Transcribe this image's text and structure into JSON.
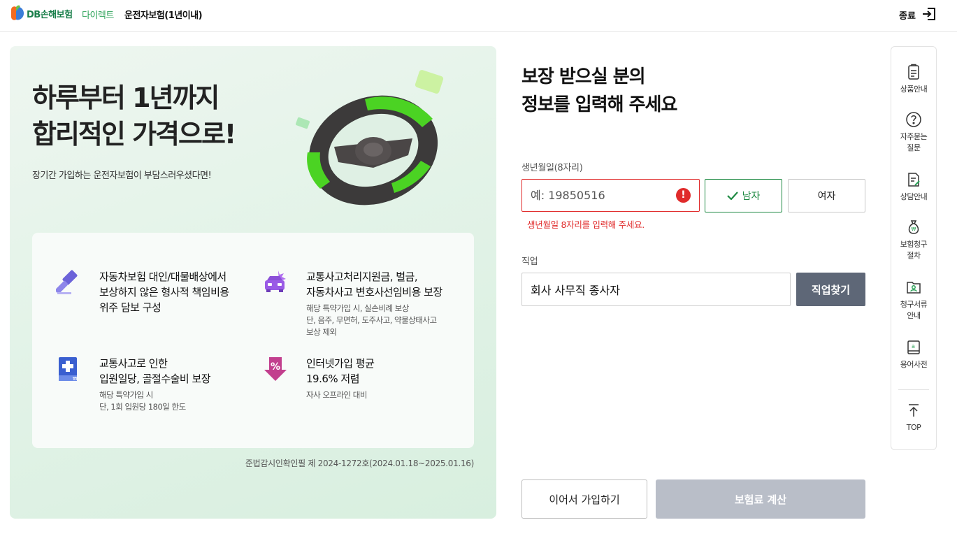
{
  "header": {
    "brand": "DB손해보험",
    "brand_sub": "다이렉트",
    "title": "운전자보험(1년이내)",
    "exit_label": "종료",
    "exit_icon": "exit-icon"
  },
  "promo": {
    "headline_line1": "하루부터 1년까지",
    "headline_line2": "합리적인 가격으로!",
    "subtitle": "장기간 가입하는 운전자보험이 부담스러우셨다면!",
    "features": [
      {
        "icon": "gavel-icon",
        "title_lines": [
          "자동차보험 대인/대물배상에서",
          "보상하지 않은 형사적 책임비용",
          "위주 담보 구성"
        ],
        "desc_lines": []
      },
      {
        "icon": "car-accident-icon",
        "title_lines": [
          "교통사고처리지원금, 벌금,",
          "자동차사고 변호사선임비용 보장"
        ],
        "desc_lines": [
          "해당 특약가입 시, 실손비례 보상",
          "단, 음주, 무면허, 도주사고, 약물상태사고",
          "보상 제외"
        ]
      },
      {
        "icon": "hospital-book-icon",
        "title_lines": [
          "교통사고로 인한",
          "입원일당, 골절수술비 보장"
        ],
        "desc_lines": [
          "해당 특약가입 시",
          "단, 1회 입원당 180일 한도"
        ]
      },
      {
        "icon": "discount-arrow-icon",
        "title_lines": [
          "인터넷가입 평균",
          "19.6% 저렴"
        ],
        "desc_lines": [
          "자사 오프라인 대비"
        ]
      }
    ],
    "approval": "준법감시인확인필 제 2024-1272호(2024.01.18~2025.01.16)"
  },
  "form": {
    "title_line1": "보장 받으실 분의",
    "title_line2": "정보를 입력해 주세요",
    "birth_label": "생년월일(8자리)",
    "birth_placeholder": "예: 19850516",
    "birth_value": "",
    "birth_error": "생년월일 8자리를 입력해 주세요.",
    "gender_male": "남자",
    "gender_female": "여자",
    "gender_selected": "남자",
    "job_label": "직업",
    "job_value": "회사 사무직 종사자",
    "job_button": "직업찾기",
    "continue_button": "이어서 가입하기",
    "calc_button": "보험료 계산"
  },
  "quick_menu": {
    "items": [
      {
        "label_lines": [
          "상품안내"
        ],
        "icon": "clipboard-icon"
      },
      {
        "label_lines": [
          "자주묻는",
          "질문"
        ],
        "icon": "question-icon"
      },
      {
        "label_lines": [
          "상담안내"
        ],
        "icon": "document-edit-icon"
      },
      {
        "label_lines": [
          "보험청구",
          "절차"
        ],
        "icon": "money-bag-icon"
      },
      {
        "label_lines": [
          "청구서류",
          "안내"
        ],
        "icon": "folder-person-icon"
      },
      {
        "label_lines": [
          "용어사전"
        ],
        "icon": "dictionary-icon"
      }
    ],
    "top_label": "TOP"
  },
  "colors": {
    "brand_green": "#1f8a43",
    "error_red": "#e02b2b",
    "job_button_bg": "#5e6777",
    "calc_disabled_bg": "#b9bec8"
  }
}
